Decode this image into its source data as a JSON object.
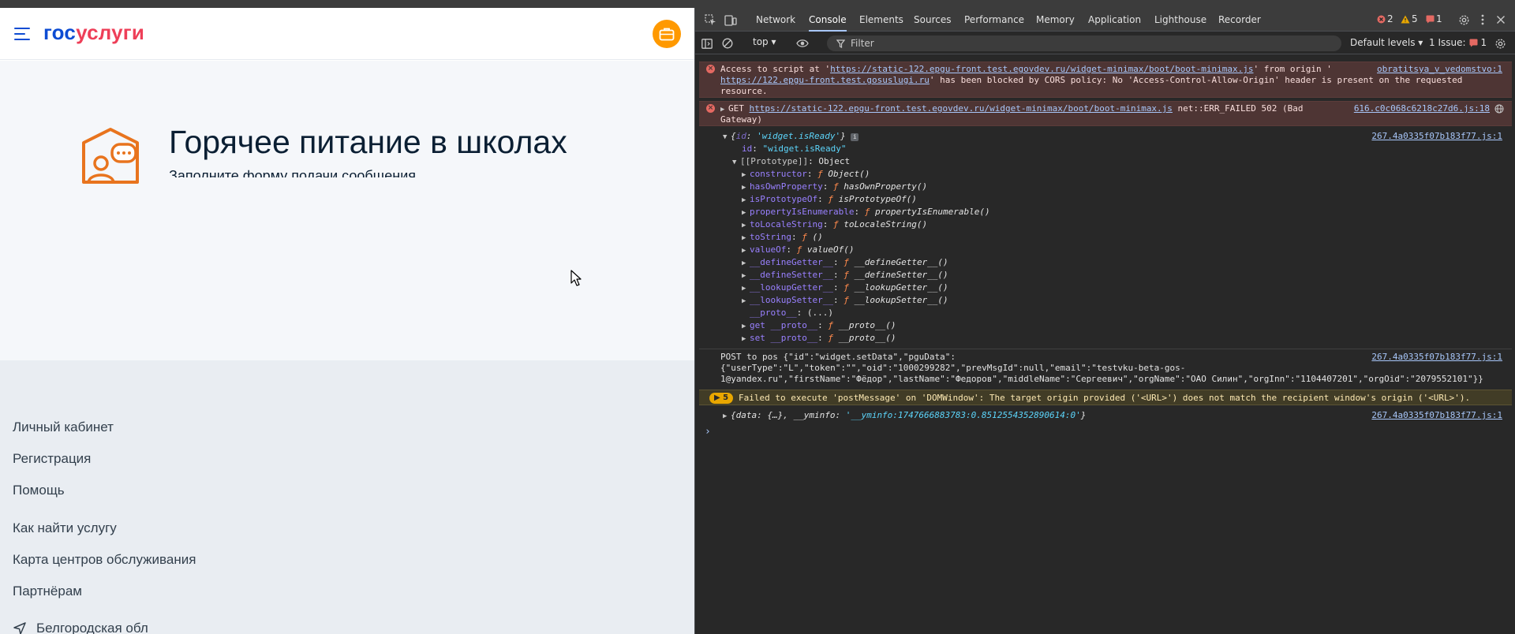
{
  "site": {
    "logo_part1": "гос",
    "logo_part2": "услуги",
    "hero_title": "Горячее питание в школах",
    "hero_subtitle": "Заполните форму подачи сообщения",
    "footer_links": [
      "Личный кабинет",
      "Регистрация",
      "Помощь",
      "Как найти услугу",
      "Карта центров обслуживания",
      "Партнёрам"
    ],
    "region": "Белгородская обл"
  },
  "devtools": {
    "tabs": [
      "Network",
      "Console",
      "Elements",
      "Sources",
      "Performance",
      "Memory",
      "Application",
      "Lighthouse",
      "Recorder"
    ],
    "active_tab": "Console",
    "error_count": "2",
    "warning_count": "5",
    "issue_badge_count": "1",
    "context": "top",
    "filter_placeholder": "Filter",
    "levels": "Default levels",
    "issues_label": "1 Issue:",
    "issues_count": "1"
  },
  "console": {
    "cors": {
      "l1a": "Access to script at '",
      "l1_url": "https://static-122.epgu-front.test.egovdev.ru/widget-minimax/boot/boot-minimax.js",
      "l1b": "' from origin '",
      "l2_url": "https://122.epgu-front.test.gosuslugi.ru",
      "l2b": "' has been blocked by CORS policy: No 'Access-Control-Allow-Origin' header is present on the requested",
      "l3": "resource.",
      "source": "obratitsya_v_vedomstvo:1"
    },
    "get_error": {
      "prefix": "GET ",
      "url": "https://static-122.epgu-front.test.egovdev.ru/widget-minimax/boot/boot-minimax.js",
      "suffix": " net::ERR_FAILED 502 (Bad",
      "line2": "Gateway)",
      "source": "616.c0c068c6218c27d6.js:18"
    },
    "object": {
      "summary_key": "id",
      "summary_value": "'widget.isReady'",
      "id_key": "id",
      "id_value": "\"widget.isReady\"",
      "proto_label": "[[Prototype]]",
      "proto_value": "Object",
      "source": "267.4a0335f07b183f77.js:1",
      "props": [
        {
          "key": "constructor",
          "value": "Object()"
        },
        {
          "key": "hasOwnProperty",
          "value": "hasOwnProperty()"
        },
        {
          "key": "isPrototypeOf",
          "value": "isPrototypeOf()"
        },
        {
          "key": "propertyIsEnumerable",
          "value": "propertyIsEnumerable()"
        },
        {
          "key": "toLocaleString",
          "value": "toLocaleString()"
        },
        {
          "key": "toString",
          "value": "()"
        },
        {
          "key": "valueOf",
          "value": "valueOf()"
        },
        {
          "key": "__defineGetter__",
          "value": "__defineGetter__()"
        },
        {
          "key": "__defineSetter__",
          "value": "__defineSetter__()"
        },
        {
          "key": "__lookupGetter__",
          "value": "__lookupGetter__()"
        },
        {
          "key": "__lookupSetter__",
          "value": "__lookupSetter__()"
        },
        {
          "key": "__proto__",
          "value": "(...)"
        },
        {
          "key": "get __proto__",
          "value": "__proto__()"
        },
        {
          "key": "set __proto__",
          "value": "__proto__()"
        }
      ]
    },
    "post": {
      "line1": "POST to pos {\"id\":\"widget.setData\",\"pguData\":",
      "line2": "{\"userType\":\"L\",\"token\":\"\",\"oid\":\"1000299282\",\"prevMsgId\":null,\"email\":\"testvku-beta-gos-",
      "line3": "1@yandex.ru\",\"firstName\":\"Фёдор\",\"lastName\":\"Федоров\",\"middleName\":\"Сергеевич\",\"orgName\":\"ОАО Силин\",\"orgInn\":\"1104407201\",\"orgOid\":\"2079552101\"}}",
      "source": "267.4a0335f07b183f77.js:1"
    },
    "warning": {
      "count": "5",
      "text": "Failed to execute 'postMessage' on 'DOMWindow': The target origin provided ('<URL>') does not match the recipient window's origin ('<URL>')."
    },
    "data_obj": {
      "text_a": "{data: {…}, __yminfo: ",
      "text_b": "'__yminfo:1747666883783:0.8512554352890614:0'",
      "text_c": "}",
      "source": "267.4a0335f07b183f77.js:1"
    }
  }
}
